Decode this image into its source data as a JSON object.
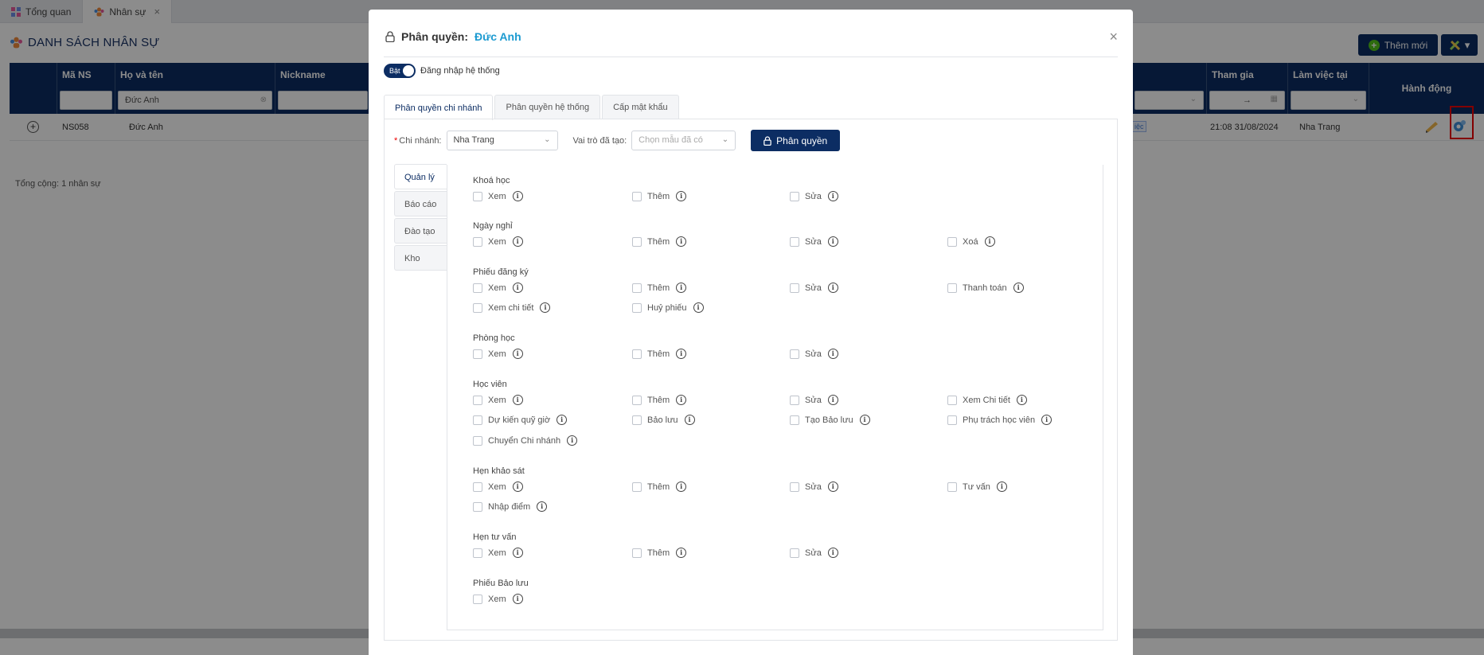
{
  "app_tabs": [
    {
      "label": "Tổng quan",
      "icon": "grid-icon"
    },
    {
      "label": "Nhân sự",
      "icon": "people-icon",
      "close": "×"
    }
  ],
  "page": {
    "title": "DANH SÁCH NHÂN SỰ",
    "add_button": "Thêm mới",
    "total": "Tổng cộng: 1 nhân sự"
  },
  "grid": {
    "columns": {
      "ma_ns": "Mã NS",
      "ho_ten": "Họ và tên",
      "nickname": "Nickname",
      "tham_gia": "Tham gia",
      "lam_viec_tai": "Làm việc tại",
      "hanh_dong": "Hành động"
    },
    "filters": {
      "ho_ten": "Đức Anh",
      "tham_gia_sep": "→"
    },
    "row": {
      "ma_ns": "NS058",
      "ho_ten": "Đức Anh",
      "tham_gia": "21:08 31/08/2024",
      "lam_viec_tai": "Nha Trang",
      "badge": "iệc"
    }
  },
  "modal": {
    "title_prefix": "Phân quyền:",
    "title_name": "Đức Anh",
    "close": "×",
    "toggle_on_label": "Bật",
    "toggle_label": "Đăng nhập hệ thống",
    "tabs": [
      "Phân quyền chi nhánh",
      "Phân quyền hệ thống",
      "Cấp mật khẩu"
    ],
    "branch_label": "Chi nhánh:",
    "branch_value": "Nha Trang",
    "role_label": "Vai trò đã tạo:",
    "role_placeholder": "Chọn mẫu đã có",
    "perm_button": "Phân quyền",
    "side_tabs": [
      "Quản lý",
      "Báo cáo",
      "Đào tạo",
      "Kho"
    ],
    "sections": {
      "khoa_hoc": {
        "title": "Khoá học",
        "items": [
          "Xem",
          "Thêm",
          "Sửa"
        ]
      },
      "ngay_nghi": {
        "title": "Ngày nghỉ",
        "items": [
          "Xem",
          "Thêm",
          "Sửa",
          "Xoá"
        ]
      },
      "phieu_dang_ky": {
        "title": "Phiếu đăng ký",
        "items": [
          "Xem",
          "Thêm",
          "Sửa",
          "Thanh toán",
          "Xem chi tiết",
          "Huỷ phiếu"
        ]
      },
      "phong_hoc": {
        "title": "Phòng học",
        "items": [
          "Xem",
          "Thêm",
          "Sửa"
        ]
      },
      "hoc_vien": {
        "title": "Học viên",
        "items": [
          "Xem",
          "Thêm",
          "Sửa",
          "Xem Chi tiết",
          "Dự kiến quỹ giờ",
          "Bảo lưu",
          "Tạo Bảo lưu",
          "Phụ trách học viên",
          "Chuyển Chi nhánh"
        ]
      },
      "hen_khao_sat": {
        "title": "Hẹn khảo sát",
        "items": [
          "Xem",
          "Thêm",
          "Sửa",
          "Tư vấn",
          "Nhập điểm"
        ]
      },
      "hen_tu_van": {
        "title": "Hẹn tư vấn",
        "items": [
          "Xem",
          "Thêm",
          "Sửa"
        ]
      },
      "phieu_bao_luu": {
        "title": "Phiếu Bảo lưu",
        "items": [
          "Xem"
        ]
      }
    }
  },
  "colors": {
    "primary": "#0c2d63",
    "accent_name": "#1d9bd1",
    "highlight": "#e00000",
    "add_icon": "#52c41a"
  }
}
